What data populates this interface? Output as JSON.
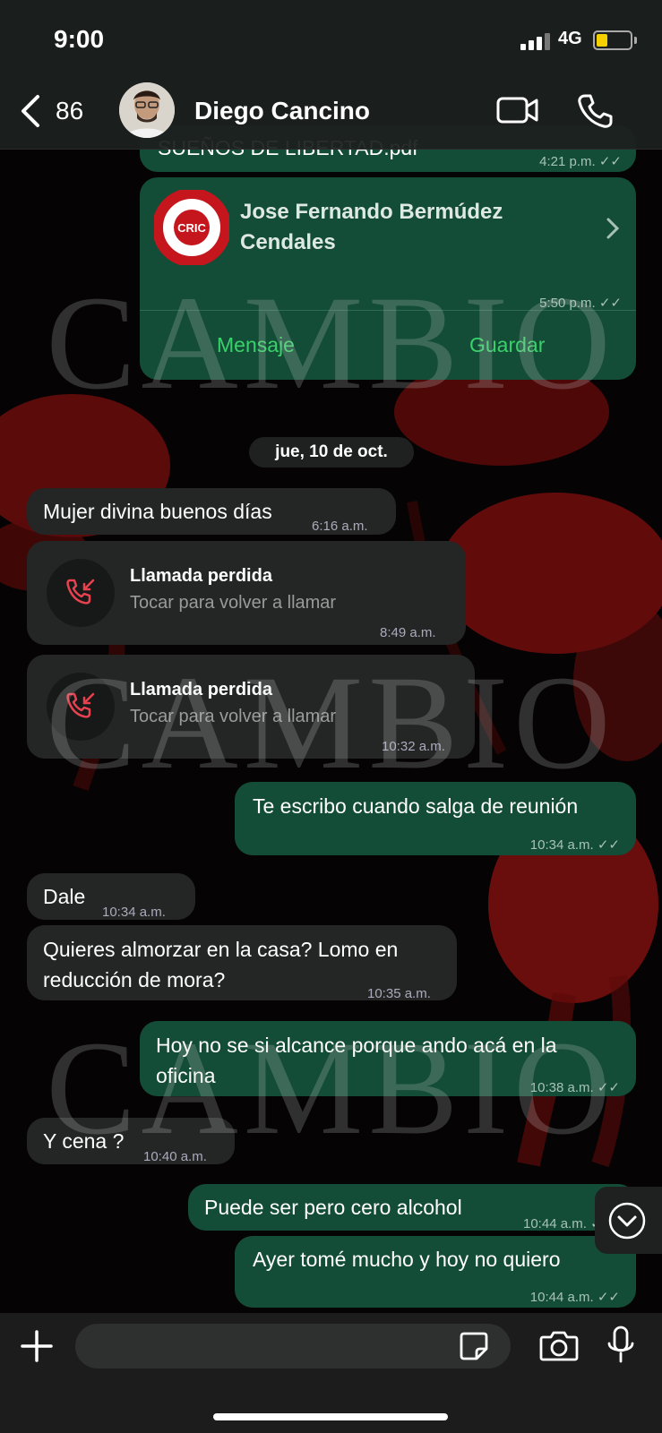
{
  "status": {
    "time": "9:00",
    "network": "4G"
  },
  "header": {
    "unread_count": "86",
    "contact_name": "Diego Cancino"
  },
  "messages": {
    "pdf": {
      "filename": "SUEÑOS DE LIBERTAD.pdf",
      "time": "4:21 p.m."
    },
    "contact_card": {
      "name_line1": "Jose Fernando Bermúdez",
      "name_line2": "Cendales",
      "time": "5:50 p.m.",
      "logo_text": "CRIC",
      "logo_ring_text": "CONSEJO REGIONAL INDIGENA DEL CAUCA",
      "action_message": "Mensaje",
      "action_save": "Guardar"
    },
    "date_divider": "jue, 10 de oct.",
    "m1": {
      "text": "Mujer divina buenos días",
      "time": "6:16 a.m."
    },
    "call1": {
      "title": "Llamada perdida",
      "subtitle": "Tocar para volver a llamar",
      "time": "8:49 a.m."
    },
    "call2": {
      "title": "Llamada perdida",
      "subtitle": "Tocar para volver a llamar",
      "time": "10:32 a.m."
    },
    "m2": {
      "text": "Te escribo cuando salga de reunión",
      "time": "10:34 a.m."
    },
    "m3": {
      "text": "Dale",
      "time": "10:34 a.m."
    },
    "m4": {
      "line1": "Quieres almorzar en la casa? Lomo en",
      "line2": "reducción de mora?",
      "time": "10:35 a.m."
    },
    "m5": {
      "line1": "Hoy no se si alcance porque ando acá en la",
      "line2": "oficina",
      "time": "10:38 a.m."
    },
    "m6": {
      "text": "Y cena ?",
      "time": "10:40 a.m."
    },
    "m7": {
      "text": "Puede ser pero cero alcohol",
      "time": "10:44 a.m."
    },
    "m8": {
      "text": "Ayer tomé mucho y hoy no quiero",
      "time": "10:44 a.m."
    }
  },
  "watermark": "CAMBIO",
  "icons": [
    "back-chevron-icon",
    "video-call-icon",
    "phone-icon",
    "missed-call-icon",
    "plus-icon",
    "sticker-icon",
    "camera-icon",
    "microphone-icon",
    "scroll-down-icon",
    "read-ticks-icon"
  ],
  "colors": {
    "outgoing_bubble": "#144d37",
    "incoming_bubble": "#242626",
    "missed_call": "#e8414f",
    "action_green": "#3ad16a",
    "battery": "#f4d000"
  }
}
